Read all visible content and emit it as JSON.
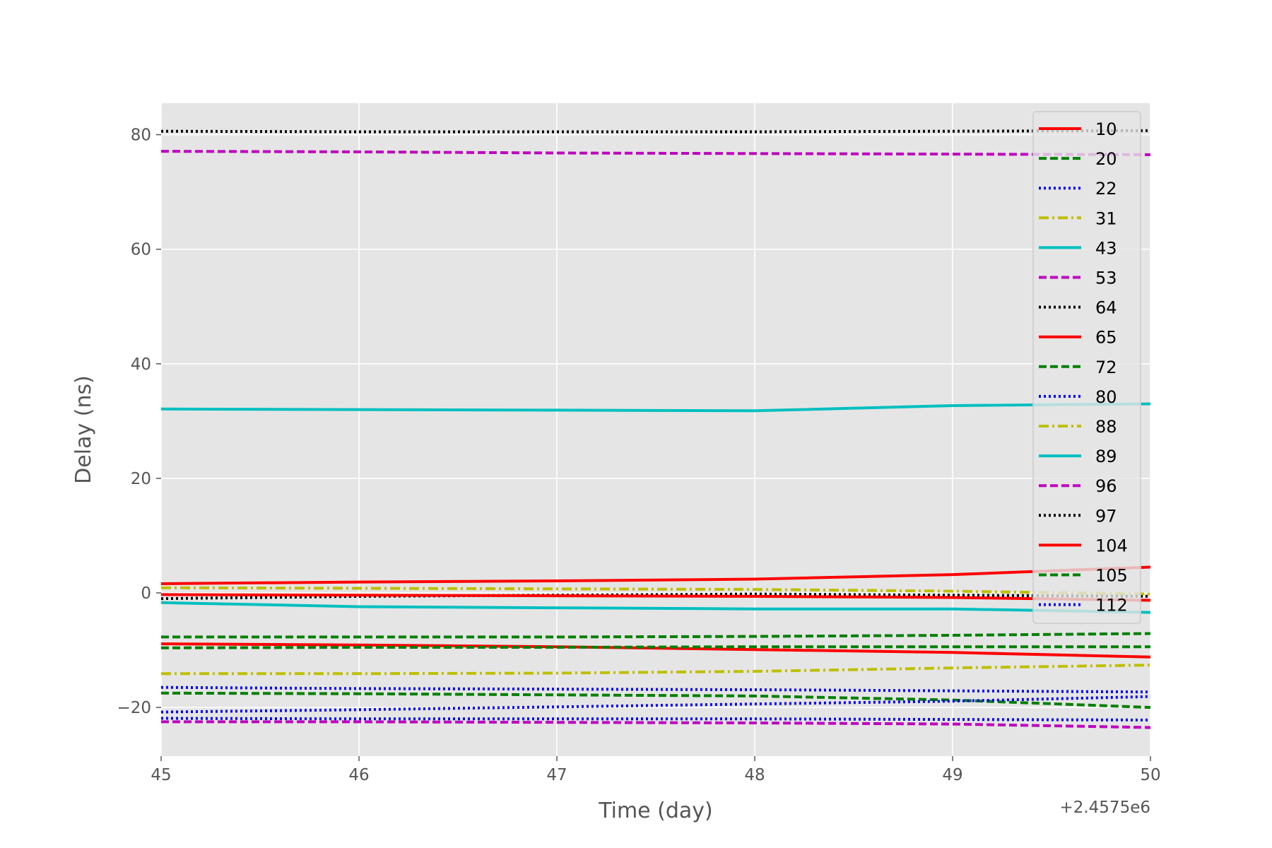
{
  "chart_data": {
    "type": "line",
    "title": "",
    "xlabel": "Time (day)",
    "ylabel": "Delay (ns)",
    "x_offset_label": "+2.4575e6",
    "x_tick_labels": [
      "45",
      "46",
      "47",
      "48",
      "49",
      "50"
    ],
    "y_tick_labels": [
      "−20",
      "0",
      "20",
      "40",
      "60",
      "80"
    ],
    "xlim": [
      45,
      50
    ],
    "ylim": [
      -28.5,
      85.5
    ],
    "x_ticks": [
      45,
      46,
      47,
      48,
      49,
      50
    ],
    "y_ticks": [
      -20,
      0,
      20,
      40,
      60,
      80
    ],
    "grid": true,
    "legend_position": "right",
    "x": [
      45,
      46,
      47,
      48,
      49,
      50
    ],
    "series": [
      {
        "name": "10",
        "color": "#ff0000",
        "style": "solid",
        "values": [
          -8.9,
          -9.1,
          -9.4,
          -9.9,
          -10.4,
          -11.2
        ]
      },
      {
        "name": "20",
        "color": "#008000",
        "style": "dashed",
        "values": [
          -17.5,
          -17.6,
          -17.8,
          -18.0,
          -18.7,
          -20.0
        ]
      },
      {
        "name": "22",
        "color": "#0000ff",
        "style": "dotted",
        "values": [
          -21.9,
          -22.0,
          -22.0,
          -22.0,
          -22.1,
          -22.2
        ]
      },
      {
        "name": "31",
        "color": "#bfbf00",
        "style": "dashdot",
        "values": [
          0.9,
          0.8,
          0.7,
          0.6,
          0.3,
          -0.2
        ]
      },
      {
        "name": "43",
        "color": "#00bfbf",
        "style": "solid",
        "values": [
          32.1,
          32.0,
          31.9,
          31.8,
          32.7,
          33.0
        ]
      },
      {
        "name": "53",
        "color": "#bf00bf",
        "style": "dashed",
        "values": [
          77.1,
          77.0,
          76.8,
          76.7,
          76.6,
          76.5
        ]
      },
      {
        "name": "64",
        "color": "#000000",
        "style": "dotted",
        "values": [
          80.6,
          80.5,
          80.5,
          80.5,
          80.6,
          80.7
        ]
      },
      {
        "name": "65",
        "color": "#ff0000",
        "style": "solid",
        "values": [
          1.6,
          1.9,
          2.1,
          2.4,
          3.2,
          4.5
        ]
      },
      {
        "name": "72",
        "color": "#008000",
        "style": "dashed",
        "values": [
          -7.7,
          -7.7,
          -7.7,
          -7.6,
          -7.4,
          -7.1
        ]
      },
      {
        "name": "80",
        "color": "#0000ff",
        "style": "dotted",
        "values": [
          -16.5,
          -16.7,
          -16.8,
          -16.9,
          -17.1,
          -17.3
        ]
      },
      {
        "name": "88",
        "color": "#bfbf00",
        "style": "dashdot",
        "values": [
          -14.1,
          -14.1,
          -14.0,
          -13.7,
          -13.1,
          -12.6
        ]
      },
      {
        "name": "89",
        "color": "#00bfbf",
        "style": "solid",
        "values": [
          -1.7,
          -2.4,
          -2.6,
          -2.8,
          -2.8,
          -3.4
        ]
      },
      {
        "name": "96",
        "color": "#bf00bf",
        "style": "dashed",
        "values": [
          -22.5,
          -22.5,
          -22.6,
          -22.7,
          -22.9,
          -23.5
        ]
      },
      {
        "name": "97",
        "color": "#000000",
        "style": "dotted",
        "values": [
          -1.0,
          -0.6,
          -0.4,
          -0.2,
          -0.4,
          -0.6
        ]
      },
      {
        "name": "104",
        "color": "#ff0000",
        "style": "solid",
        "values": [
          -0.3,
          -0.4,
          -0.5,
          -0.6,
          -0.8,
          -1.3
        ]
      },
      {
        "name": "105",
        "color": "#008000",
        "style": "dashed",
        "values": [
          -9.6,
          -9.5,
          -9.5,
          -9.4,
          -9.4,
          -9.4
        ]
      },
      {
        "name": "112",
        "color": "#0000ff",
        "style": "dotted",
        "values": [
          -20.8,
          -20.4,
          -19.9,
          -19.4,
          -18.9,
          -18.1
        ]
      }
    ]
  }
}
